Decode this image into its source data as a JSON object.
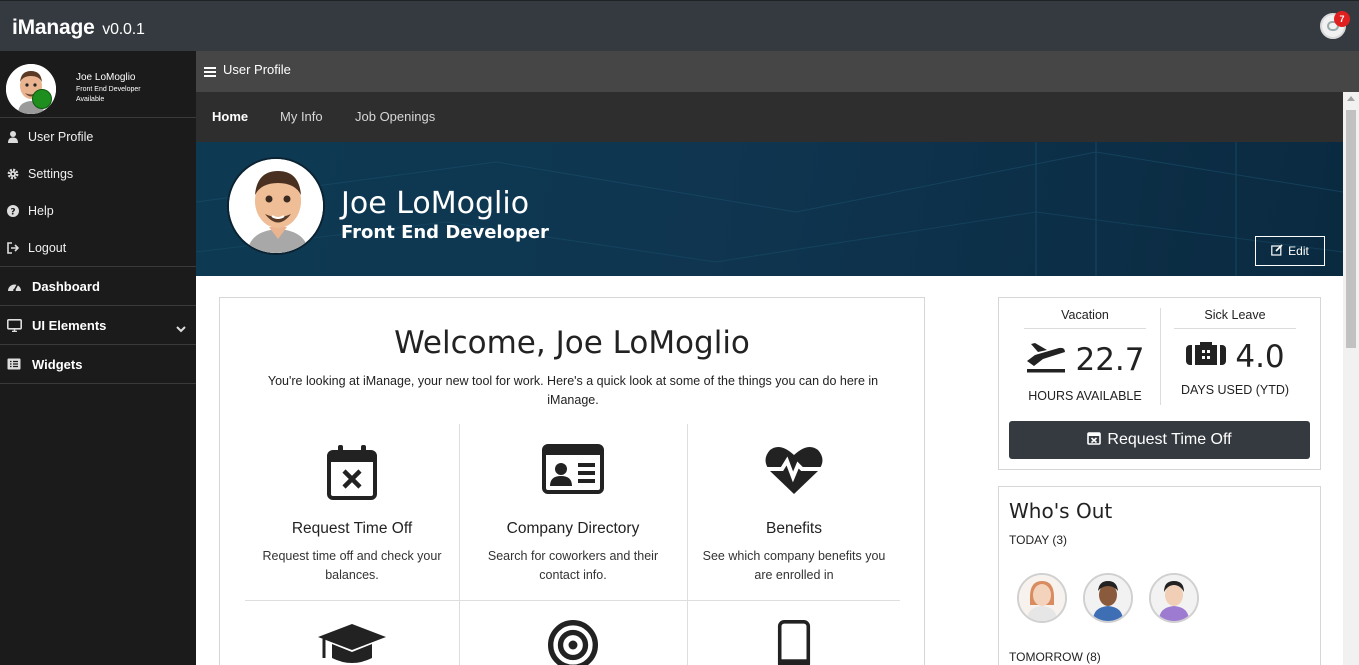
{
  "app": {
    "title": "iManage",
    "version": "v0.0.1"
  },
  "notifications": {
    "count": "7"
  },
  "sidebar": {
    "user": {
      "name": "Joe LoMoglio",
      "role": "Front End Developer",
      "status": "Available"
    },
    "items": [
      {
        "label": "User Profile",
        "icon": "user-icon"
      },
      {
        "label": "Settings",
        "icon": "gear-icon"
      },
      {
        "label": "Help",
        "icon": "question-icon"
      },
      {
        "label": "Logout",
        "icon": "sign-out-icon"
      }
    ],
    "sections": [
      {
        "label": "Dashboard",
        "icon": "dashboard-icon"
      },
      {
        "label": "UI Elements",
        "icon": "monitor-icon"
      },
      {
        "label": "Widgets",
        "icon": "list-alt-icon"
      }
    ]
  },
  "header": {
    "title": "User Profile"
  },
  "tabs": [
    {
      "label": "Home",
      "active": true
    },
    {
      "label": "My Info",
      "active": false
    },
    {
      "label": "Job Openings",
      "active": false
    }
  ],
  "banner": {
    "name": "Joe LoMoglio",
    "role": "Front End Developer",
    "edit_label": "Edit"
  },
  "welcome": {
    "title": "Welcome, Joe LoMoglio",
    "description": "You're looking at iManage, your new tool for work. Here's a quick look at some of the things you can do here in iManage.",
    "features": [
      {
        "title": "Request Time Off",
        "description": "Request time off and check your balances.",
        "icon": "calendar-times-icon"
      },
      {
        "title": "Company Directory",
        "description": "Search for coworkers and their contact info.",
        "icon": "id-card-icon"
      },
      {
        "title": "Benefits",
        "description": "See which company benefits you are enrolled in",
        "icon": "heartbeat-icon"
      }
    ],
    "more_icons": [
      "graduation-cap-icon",
      "bullseye-icon",
      "mobile-icon"
    ]
  },
  "leave": {
    "vacation": {
      "label": "Vacation",
      "value": "22.7",
      "sub": "HOURS AVAILABLE",
      "icon": "plane-icon"
    },
    "sick": {
      "label": "Sick Leave",
      "value": "4.0",
      "sub": "DAYS USED (YTD)",
      "icon": "medkit-icon"
    },
    "request_label": "Request Time Off"
  },
  "whos_out": {
    "title": "Who's Out",
    "today": "TODAY (3)",
    "tomorrow": "TOMORROW (8)"
  },
  "colors": {
    "navbar": "#343a40",
    "sidebar": "#1b1b1b",
    "header": "#464646",
    "status_available": "#1e8e1e",
    "badge": "#e0201f"
  }
}
